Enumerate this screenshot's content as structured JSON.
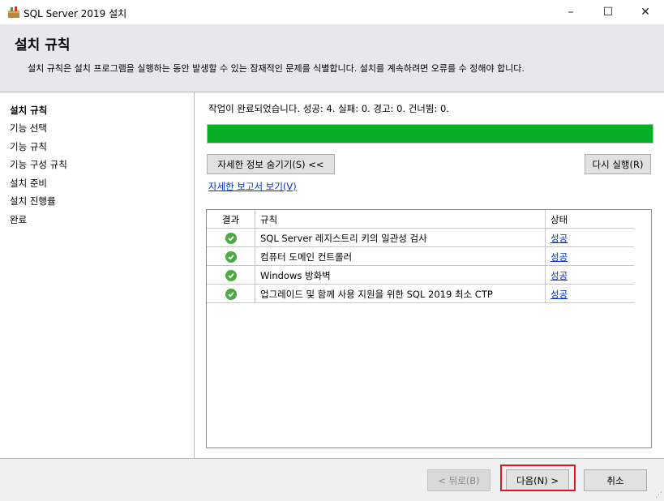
{
  "window": {
    "title": "SQL Server 2019 설치",
    "minimize": "–",
    "maximize": "☐",
    "close": "✕"
  },
  "header": {
    "title": "설치 규칙",
    "description": "설치 규칙은 설치 프로그램을 실행하는 동안 발생할 수 있는 잠재적인 문제를 식별합니다. 설치를 계속하려면 오류를 수 정해야 합니다."
  },
  "sidebar": {
    "items": [
      {
        "label": "설치 규칙",
        "active": true
      },
      {
        "label": "기능 선택"
      },
      {
        "label": "기능 규칙"
      },
      {
        "label": "기능 구성 규칙"
      },
      {
        "label": "설치 준비"
      },
      {
        "label": "설치 진행률"
      },
      {
        "label": "완료"
      }
    ]
  },
  "main": {
    "status_text": "작업이 완료되었습니다. 성공: 4. 실패: 0. 경고: 0. 건너뜀: 0.",
    "progress_percent": 100,
    "progress_color": "#06b025",
    "hide_details_button": "자세한 정보 숨기기(S) <<",
    "rerun_button": "다시 실행(R)",
    "report_link": "자세한 보고서 보기(V)",
    "table": {
      "headers": [
        "결과",
        "규칙",
        "상태"
      ],
      "rows": [
        {
          "result_icon": "check-icon",
          "rule": "SQL Server 레지스트리 키의 일관성 검사",
          "status": "성공"
        },
        {
          "result_icon": "check-icon",
          "rule": "컴퓨터 도메인 컨트롤러",
          "status": "성공"
        },
        {
          "result_icon": "check-icon",
          "rule": "Windows 방화벽",
          "status": "성공"
        },
        {
          "result_icon": "check-icon",
          "rule": "업그레이드 및 함께 사용 지원을 위한 SQL 2019 최소 CTP",
          "status": "성공"
        }
      ]
    }
  },
  "footer": {
    "back_button": "< 뒤로(B)",
    "next_button": "다음(N) >",
    "cancel_button": "취소"
  }
}
